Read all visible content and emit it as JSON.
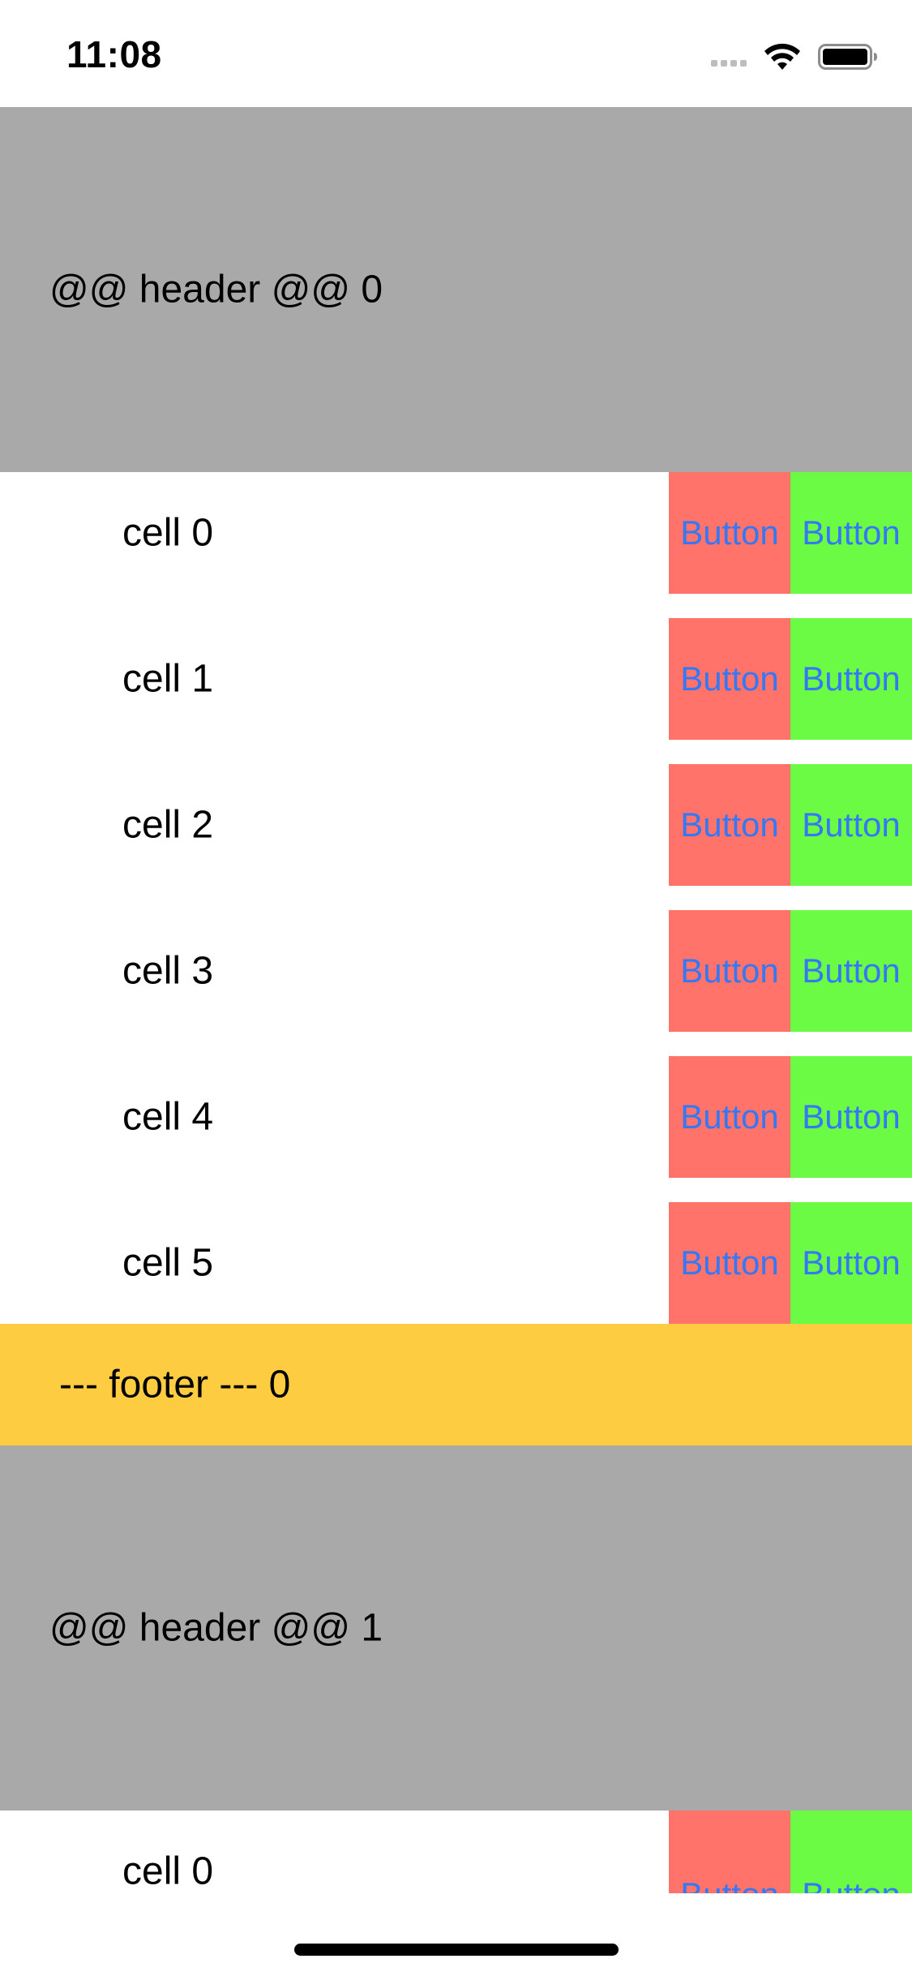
{
  "status_bar": {
    "time": "11:08",
    "icons": [
      "cellular-signal-icon",
      "wifi-icon",
      "battery-icon"
    ]
  },
  "colors": {
    "header_bg": "#a9a9a9",
    "footer_bg": "#fdcc40",
    "button_red_bg": "#ff736a",
    "button_green_bg": "#6cfb45",
    "button_text": "#3478f6"
  },
  "table": {
    "sections": [
      {
        "header": "@@ header @@ 0",
        "cells": [
          {
            "label": "cell 0",
            "button_1": "Button",
            "button_2": "Button"
          },
          {
            "label": "cell 1",
            "button_1": "Button",
            "button_2": "Button"
          },
          {
            "label": "cell 2",
            "button_1": "Button",
            "button_2": "Button"
          },
          {
            "label": "cell 3",
            "button_1": "Button",
            "button_2": "Button"
          },
          {
            "label": "cell 4",
            "button_1": "Button",
            "button_2": "Button"
          },
          {
            "label": "cell 5",
            "button_1": "Button",
            "button_2": "Button"
          }
        ],
        "footer": "--- footer --- 0"
      },
      {
        "header": "@@ header @@ 1",
        "cells": [
          {
            "label": "cell 0",
            "button_1": "Button",
            "button_2": "Button"
          }
        ]
      }
    ]
  }
}
